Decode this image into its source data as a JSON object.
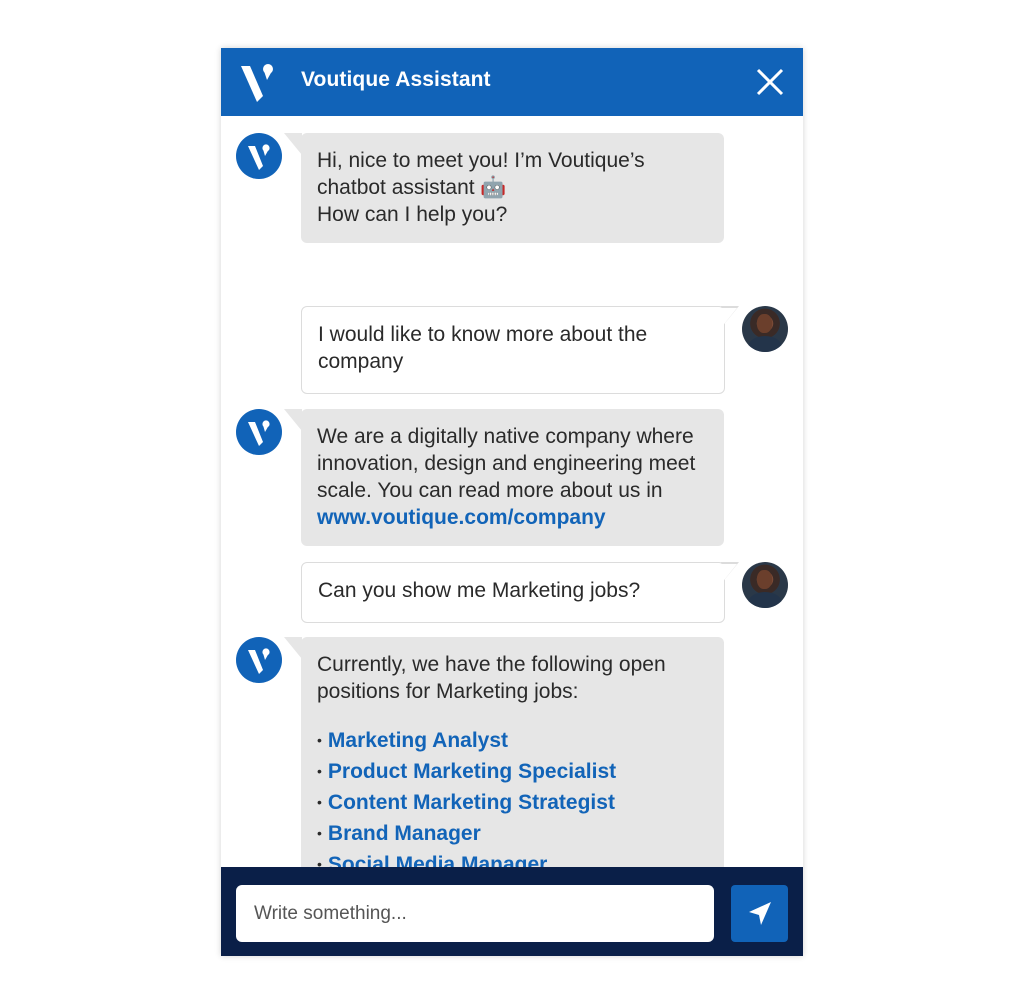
{
  "header": {
    "title": "Voutique Assistant",
    "logo_icon": "voutique-v-logo",
    "close_icon": "close-icon",
    "color": "#1163b8"
  },
  "messages": [
    {
      "sender": "bot",
      "lines": [
        "Hi, nice to meet you!  I’m Voutique’s",
        "chatbot assistant 🤖",
        "How can I help you?"
      ]
    },
    {
      "sender": "user",
      "lines": [
        "I would like to know more about the",
        "company"
      ]
    },
    {
      "sender": "bot",
      "lines": [
        "We are a digitally native company where",
        "innovation, design and engineering meet",
        "scale. You can read more about us in"
      ],
      "link": "www.voutique.com/company"
    },
    {
      "sender": "user",
      "lines": [
        "Can you show me Marketing jobs?"
      ]
    },
    {
      "sender": "bot",
      "lines": [
        "Currently, we have the following open",
        "positions for Marketing jobs:"
      ],
      "jobs": [
        "Marketing Analyst",
        "Product Marketing Specialist",
        "Content Marketing Strategist",
        "Brand Manager",
        "Social Media Manager"
      ]
    }
  ],
  "composer": {
    "placeholder": "Write something...",
    "value": "",
    "send_icon": "send-icon",
    "footer_color": "#0a1f48"
  },
  "colors": {
    "accent": "#1163b8",
    "link": "#1264b8",
    "bot_bubble": "#e6e6e6",
    "user_bubble_border": "#dcdcdc"
  }
}
